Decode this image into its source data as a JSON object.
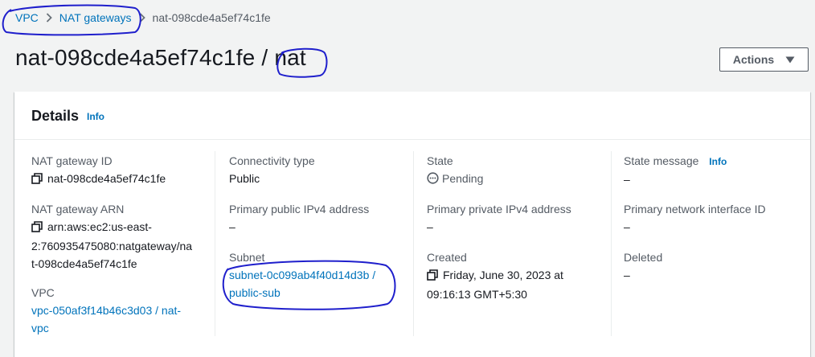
{
  "breadcrumb": {
    "vpc": "VPC",
    "nat_gateways": "NAT gateways",
    "current": "nat-098cde4a5ef74c1fe"
  },
  "page": {
    "title": "nat-098cde4a5ef74c1fe / nat"
  },
  "actions": {
    "label": "Actions"
  },
  "details": {
    "title": "Details",
    "info": "Info",
    "nat_gateway_id": {
      "label": "NAT gateway ID",
      "value": "nat-098cde4a5ef74c1fe"
    },
    "nat_gateway_arn": {
      "label": "NAT gateway ARN",
      "line1": "arn:aws:ec2:us-east-",
      "line2": "2:760935475080:natgateway/na",
      "line3": "t-098cde4a5ef74c1fe"
    },
    "vpc": {
      "label": "VPC",
      "line1": "vpc-050af3f14b46c3d03 / nat-",
      "line2": "vpc"
    },
    "connectivity_type": {
      "label": "Connectivity type",
      "value": "Public"
    },
    "primary_public_ipv4": {
      "label": "Primary public IPv4 address",
      "value": "–"
    },
    "subnet": {
      "label": "Subnet",
      "line1": "subnet-0c099ab4f40d14d3b /",
      "line2": "public-sub"
    },
    "state": {
      "label": "State",
      "value": "Pending"
    },
    "primary_private_ipv4": {
      "label": "Primary private IPv4 address",
      "value": "–"
    },
    "created": {
      "label": "Created",
      "line1": "Friday, June 30, 2023 at",
      "line2": "09:16:13 GMT+5:30"
    },
    "state_message": {
      "label": "State message",
      "info": "Info",
      "value": "–"
    },
    "primary_network_interface_id": {
      "label": "Primary network interface ID",
      "value": "–"
    },
    "deleted": {
      "label": "Deleted",
      "value": "–"
    }
  },
  "colors": {
    "link": "#0073bb",
    "annotation_ink": "#1f1fcc",
    "label": "#545b64",
    "text": "#16191f"
  },
  "icons": [
    "chevron-right-icon",
    "caret-down-icon",
    "copy-icon",
    "pending-status-icon"
  ]
}
